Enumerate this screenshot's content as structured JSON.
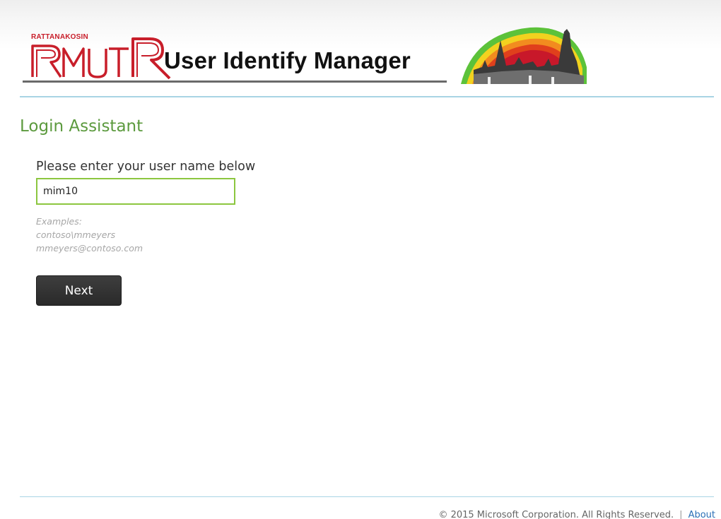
{
  "header": {
    "logo_small_text": "RATTANAKOSIN",
    "logo_letters": "RMUTR",
    "app_title": "User Identify Manager",
    "brand_red": "#c81e2a"
  },
  "content": {
    "title": "Login Assistant",
    "prompt": "Please enter your user name below",
    "username_value": "mim10",
    "examples_heading": "Examples:",
    "examples": [
      "contoso\\mmeyers",
      "mmeyers@contoso.com"
    ],
    "next_label": "Next"
  },
  "footer": {
    "copyright": "© 2015 Microsoft Corporation. All Rights Reserved.",
    "separator": "|",
    "about_link": "About"
  },
  "colors": {
    "title_green": "#5c9a3e",
    "input_border_green": "#8cc63f",
    "rule_blue": "#a8d4e4",
    "link_blue": "#2a6fb6"
  }
}
